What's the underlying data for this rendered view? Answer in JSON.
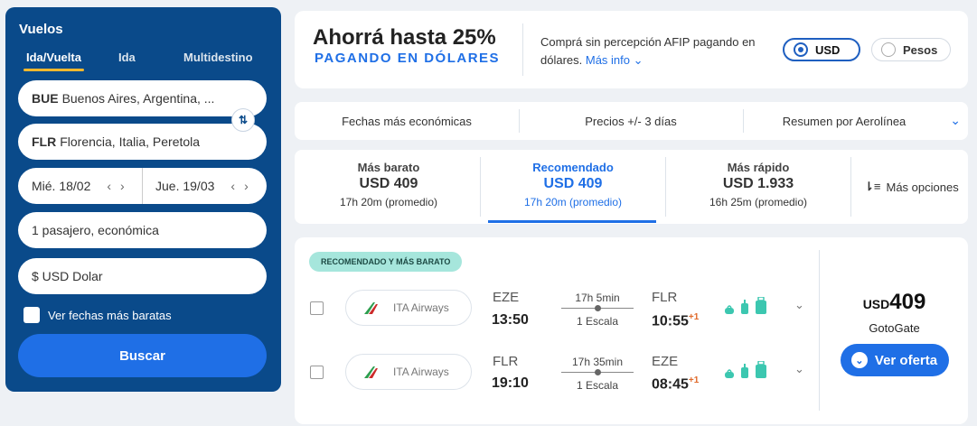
{
  "search": {
    "title": "Vuelos",
    "tabs": [
      {
        "label": "Ida/Vuelta"
      },
      {
        "label": "Ida"
      },
      {
        "label": "Multidestino"
      }
    ],
    "origin": {
      "code": "BUE",
      "name": "Buenos Aires, Argentina, ..."
    },
    "destination": {
      "code": "FLR",
      "name": "Florencia, Italia, Peretola"
    },
    "depart_date": "Mié. 18/02",
    "return_date": "Jue. 19/03",
    "passengers": "1 pasajero, económica",
    "currency": "$ USD Dolar",
    "cheap_dates_label": "Ver fechas más baratas",
    "search_button": "Buscar"
  },
  "promo": {
    "title": "Ahorrá hasta 25%",
    "subtitle": "PAGANDO EN DÓLARES",
    "text": "Comprá sin percepción AFIP pagando en dólares.",
    "link": "Más info",
    "options": [
      {
        "label": "USD",
        "selected": true
      },
      {
        "label": "Pesos",
        "selected": false
      }
    ]
  },
  "filters": [
    {
      "label": "Fechas más económicas"
    },
    {
      "label": "Precios +/- 3 días"
    },
    {
      "label": "Resumen por Aerolínea"
    }
  ],
  "sort_tabs": [
    {
      "label": "Más barato",
      "price": "USD 409",
      "duration": "17h 20m (promedio)"
    },
    {
      "label": "Recomendado",
      "price": "USD 409",
      "duration": "17h 20m (promedio)"
    },
    {
      "label": "Más rápido",
      "price": "USD 1.933",
      "duration": "16h 25m (promedio)"
    }
  ],
  "more_options": "Más opciones",
  "result": {
    "badge": "RECOMENDADO Y MÁS BARATO",
    "legs": [
      {
        "airline": "ITA Airways",
        "from": "EZE",
        "depart": "13:50",
        "duration": "17h 5min",
        "stops": "1 Escala",
        "to": "FLR",
        "arrive": "10:55",
        "plus_day": "+1"
      },
      {
        "airline": "ITA Airways",
        "from": "FLR",
        "depart": "19:10",
        "duration": "17h 35min",
        "stops": "1 Escala",
        "to": "EZE",
        "arrive": "08:45",
        "plus_day": "+1"
      }
    ],
    "currency": "USD",
    "price": "409",
    "provider": "GotoGate",
    "offer_button": "Ver oferta"
  },
  "colors": {
    "panel": "#0a4a8a",
    "accent": "#1f6fe6",
    "badge": "#a6e6dc",
    "baggage": "#3cc7b0"
  }
}
